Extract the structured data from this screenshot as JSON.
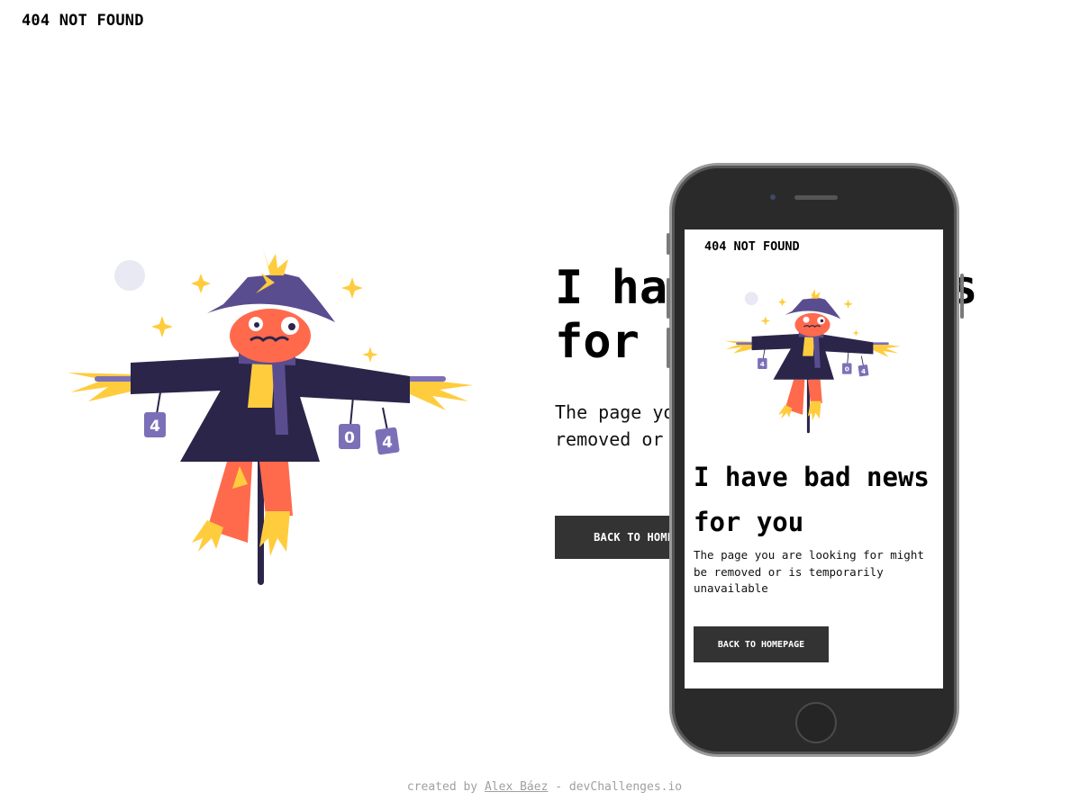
{
  "brand": "404 NOT FOUND",
  "headline": "I have bad news for you",
  "description": "The page you are looking for might be removed or is temporarily unavailable",
  "back_button_label": "BACK TO HOMEPAGE",
  "mobile": {
    "brand": "404 NOT FOUND",
    "headline": "I have bad news for you",
    "description": "The page you are looking for might be removed or is temporarily unavailable",
    "back_button_label": "BACK TO HOMEPAGE"
  },
  "illustration": {
    "can_labels": [
      "4",
      "0",
      "4"
    ]
  },
  "footer": {
    "prefix": "created by",
    "author": "Alex Báez",
    "separator": " - ",
    "site": "devChallenges.io"
  },
  "colors": {
    "button_bg": "#333333",
    "hat": "#5a4d8f",
    "coat": "#2b2549",
    "face": "#ff6a4d",
    "straw": "#ffcc3d",
    "can": "#7b70b8",
    "moon": "#e8e9f3"
  }
}
